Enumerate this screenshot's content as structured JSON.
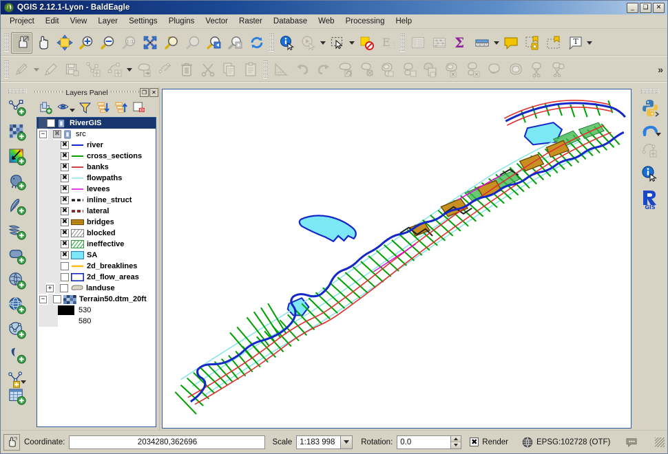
{
  "window": {
    "title": "QGIS 2.12.1-Lyon - BaldEagle",
    "app_icon": "qgis-logo-icon",
    "minimize": "_",
    "maximize": "❑",
    "close": "✕"
  },
  "menubar": {
    "items": [
      {
        "label": "Project",
        "name": "menu-project"
      },
      {
        "label": "Edit",
        "name": "menu-edit"
      },
      {
        "label": "View",
        "name": "menu-view"
      },
      {
        "label": "Layer",
        "name": "menu-layer"
      },
      {
        "label": "Settings",
        "name": "menu-settings"
      },
      {
        "label": "Plugins",
        "name": "menu-plugins"
      },
      {
        "label": "Vector",
        "name": "menu-vector"
      },
      {
        "label": "Raster",
        "name": "menu-raster"
      },
      {
        "label": "Database",
        "name": "menu-database"
      },
      {
        "label": "Web",
        "name": "menu-web"
      },
      {
        "label": "Processing",
        "name": "menu-processing"
      },
      {
        "label": "Help",
        "name": "menu-help"
      }
    ]
  },
  "toolbar_map_navigation": {
    "overflow_label": "»",
    "buttons": [
      {
        "name": "touch-zoom-pan-icon",
        "title": "Touch zoom and pan",
        "state": "active"
      },
      {
        "name": "pan-map-icon",
        "title": "Pan Map",
        "state": "enabled"
      },
      {
        "name": "pan-map-to-selection-icon",
        "title": "Pan Map to Selection",
        "state": "enabled"
      },
      {
        "name": "zoom-in-icon",
        "title": "Zoom In",
        "state": "enabled"
      },
      {
        "name": "zoom-out-icon",
        "title": "Zoom Out",
        "state": "enabled"
      },
      {
        "name": "zoom-native-resolution-icon",
        "title": "Zoom to Native Resolution",
        "state": "disabled"
      },
      {
        "name": "zoom-full-icon",
        "title": "Zoom Full",
        "state": "enabled"
      },
      {
        "name": "zoom-to-selection-icon",
        "title": "Zoom to Selection",
        "state": "enabled"
      },
      {
        "name": "zoom-to-layer-icon",
        "title": "Zoom to Layer",
        "state": "disabled"
      },
      {
        "name": "zoom-last-icon",
        "title": "Zoom Last",
        "state": "enabled"
      },
      {
        "name": "zoom-next-icon",
        "title": "Zoom Next",
        "state": "enabled"
      },
      {
        "name": "refresh-icon",
        "title": "Refresh",
        "state": "enabled"
      },
      {
        "name": "identify-features-icon",
        "title": "Identify Features",
        "state": "enabled"
      },
      {
        "name": "run-feature-action-icon",
        "title": "Run Feature Action",
        "state": "disabled"
      },
      {
        "name": "select-features-icon",
        "title": "Select Features by area or single click",
        "state": "enabled"
      },
      {
        "name": "deselect-features-icon",
        "title": "Deselect Features from All Layers",
        "state": "enabled"
      },
      {
        "name": "select-by-expression-icon",
        "title": "Select Features using an Expression",
        "state": "disabled"
      },
      {
        "name": "open-attribute-table-icon",
        "title": "Open Attribute Table",
        "state": "disabled"
      },
      {
        "name": "field-calculator-icon",
        "title": "Open Field Calculator",
        "state": "disabled"
      },
      {
        "name": "statistical-summary-icon",
        "title": "Show Statistical Summary",
        "state": "enabled"
      },
      {
        "name": "measure-line-icon",
        "title": "Measure Line",
        "state": "enabled"
      },
      {
        "name": "map-tips-icon",
        "title": "Show Map Tips",
        "state": "enabled"
      },
      {
        "name": "new-bookmark-icon",
        "title": "New Bookmark",
        "state": "enabled"
      },
      {
        "name": "show-bookmarks-icon",
        "title": "Show Bookmarks",
        "state": "enabled"
      },
      {
        "name": "text-annotation-icon",
        "title": "Text Annotation",
        "state": "enabled"
      }
    ]
  },
  "toolbar_digitizing": {
    "buttons": [
      {
        "name": "current-edits-icon",
        "title": "Current Edits",
        "state": "disabled"
      },
      {
        "name": "toggle-editing-icon",
        "title": "Toggle Editing",
        "state": "disabled"
      },
      {
        "name": "save-layer-edits-icon",
        "title": "Save Layer Edits",
        "state": "disabled"
      },
      {
        "name": "add-feature-node-icon",
        "title": "Add Feature",
        "state": "disabled"
      },
      {
        "name": "add-feature-line-icon",
        "title": "Add Feature",
        "state": "disabled"
      },
      {
        "name": "move-feature-icon",
        "title": "Move Feature",
        "state": "disabled"
      },
      {
        "name": "node-tool-icon",
        "title": "Node Tool",
        "state": "disabled"
      },
      {
        "name": "delete-selected-icon",
        "title": "Delete Selected",
        "state": "disabled"
      },
      {
        "name": "cut-features-icon",
        "title": "Cut Features",
        "state": "disabled"
      },
      {
        "name": "copy-features-icon",
        "title": "Copy Features",
        "state": "disabled"
      },
      {
        "name": "paste-features-icon",
        "title": "Paste Features",
        "state": "disabled"
      },
      {
        "name": "enable-tracing-icon",
        "title": "Enable Tracing",
        "state": "disabled"
      },
      {
        "name": "undo-icon",
        "title": "Undo",
        "state": "disabled"
      },
      {
        "name": "redo-icon",
        "title": "Redo",
        "state": "disabled"
      },
      {
        "name": "rotate-feature-icon",
        "title": "Rotate Feature",
        "state": "disabled"
      },
      {
        "name": "simplify-feature-icon",
        "title": "Simplify Feature",
        "state": "disabled"
      },
      {
        "name": "add-ring-icon",
        "title": "Add Ring",
        "state": "disabled"
      },
      {
        "name": "add-part-icon",
        "title": "Add Part",
        "state": "disabled"
      },
      {
        "name": "fill-ring-icon",
        "title": "Fill Ring",
        "state": "disabled"
      },
      {
        "name": "delete-ring-icon",
        "title": "Delete Ring",
        "state": "disabled"
      },
      {
        "name": "delete-part-icon",
        "title": "Delete Part",
        "state": "disabled"
      },
      {
        "name": "reshape-features-icon",
        "title": "Reshape Features",
        "state": "disabled"
      },
      {
        "name": "offset-curve-icon",
        "title": "Offset Curve",
        "state": "disabled"
      },
      {
        "name": "split-features-icon",
        "title": "Split Features",
        "state": "disabled"
      },
      {
        "name": "split-parts-icon",
        "title": "Split Parts",
        "state": "disabled"
      }
    ]
  },
  "toolbar_manage_layers": {
    "buttons": [
      {
        "name": "add-vector-layer-icon",
        "title": "Add Vector Layer",
        "state": "enabled"
      },
      {
        "name": "add-raster-layer-icon",
        "title": "Add Raster Layer",
        "state": "enabled"
      },
      {
        "name": "add-mesh-layer-icon",
        "title": "Add Mesh Layer",
        "state": "enabled"
      },
      {
        "name": "add-postgis-layer-icon",
        "title": "Add PostGIS Layers",
        "state": "enabled"
      },
      {
        "name": "add-spatialite-layer-icon",
        "title": "Add SpatiaLite Layer",
        "state": "enabled"
      },
      {
        "name": "add-mssql-layer-icon",
        "title": "Add MSSQL Spatial Layer",
        "state": "enabled"
      },
      {
        "name": "add-oracle-layer-icon",
        "title": "Add Oracle Spatial Layer",
        "state": "enabled"
      },
      {
        "name": "add-wms-layer-icon",
        "title": "Add WMS/WMTS Layer",
        "state": "enabled"
      },
      {
        "name": "add-wcs-layer-icon",
        "title": "Add WCS Layer",
        "state": "enabled"
      },
      {
        "name": "add-wfs-layer-icon",
        "title": "Add WFS Layer",
        "state": "enabled"
      },
      {
        "name": "add-delimited-text-layer-icon",
        "title": "Add Delimited Text Layer",
        "state": "enabled"
      },
      {
        "name": "new-shapefile-layer-icon",
        "title": "New Shapefile Layer",
        "state": "enabled"
      },
      {
        "name": "new-memory-layer-icon",
        "title": "New Memory Layer",
        "state": "enabled"
      }
    ]
  },
  "toolbar_plugins": {
    "buttons": [
      {
        "name": "python-console-icon",
        "title": "Python Console",
        "state": "enabled"
      },
      {
        "name": "georeferencer-icon",
        "title": "Georeferencer",
        "state": "enabled"
      },
      {
        "name": "network-analysis-icon",
        "title": "Network Analysis",
        "state": "disabled"
      },
      {
        "name": "metadata-info-icon",
        "title": "Metadata",
        "state": "enabled"
      },
      {
        "name": "rivergis-icon",
        "title": "RiverGIS",
        "state": "enabled"
      }
    ]
  },
  "layers_panel": {
    "title": "Layers Panel",
    "float_button": "❐",
    "close_button": "✕",
    "toolbar": [
      {
        "name": "add-group-icon",
        "title": "Add Group"
      },
      {
        "name": "manage-visibility-icon",
        "title": "Manage Layer Visibility"
      },
      {
        "name": "filter-legend-icon",
        "title": "Filter Legend By Map Content"
      },
      {
        "name": "expand-all-icon",
        "title": "Expand All"
      },
      {
        "name": "collapse-all-icon",
        "title": "Collapse All"
      },
      {
        "name": "remove-layer-icon",
        "title": "Remove Layer/Group"
      }
    ],
    "tree": [
      {
        "label": "RiverGIS",
        "indent": 0,
        "checkbox": "unchecked",
        "selected": true,
        "expander": "none",
        "icon": "group-icon",
        "bold": true
      },
      {
        "label": "src",
        "indent": 1,
        "checkbox": "grayed",
        "selected": false,
        "expander": "minus",
        "icon": "group-icon",
        "bold": false
      },
      {
        "label": "river",
        "indent": 2,
        "checkbox": "checked",
        "selected": false,
        "expander": "none",
        "symbol": "line",
        "color": "#1428c8",
        "bold": true
      },
      {
        "label": "cross_sections",
        "indent": 2,
        "checkbox": "checked",
        "selected": false,
        "expander": "none",
        "symbol": "line",
        "color": "#00a000",
        "bold": true
      },
      {
        "label": "banks",
        "indent": 2,
        "checkbox": "checked",
        "selected": false,
        "expander": "none",
        "symbol": "line",
        "color": "#c00000",
        "bold": true
      },
      {
        "label": "flowpaths",
        "indent": 2,
        "checkbox": "checked",
        "selected": false,
        "expander": "none",
        "symbol": "line",
        "color": "#8ce6e6",
        "bold": true
      },
      {
        "label": "levees",
        "indent": 2,
        "checkbox": "checked",
        "selected": false,
        "expander": "none",
        "symbol": "line",
        "color": "#e000e0",
        "bold": true
      },
      {
        "label": "inline_struct",
        "indent": 2,
        "checkbox": "checked",
        "selected": false,
        "expander": "none",
        "symbol": "dash",
        "color": "#1a1a1a",
        "bold": true
      },
      {
        "label": "lateral",
        "indent": 2,
        "checkbox": "checked",
        "selected": false,
        "expander": "none",
        "symbol": "dash",
        "color": "#a02020",
        "bold": true
      },
      {
        "label": "bridges",
        "indent": 2,
        "checkbox": "checked",
        "selected": false,
        "expander": "none",
        "symbol": "fill",
        "color": "#c08820",
        "bold": true
      },
      {
        "label": "blocked",
        "indent": 2,
        "checkbox": "checked",
        "selected": false,
        "expander": "none",
        "symbol": "hatch-gray",
        "color": "#8a8a8a",
        "bold": true
      },
      {
        "label": "ineffective",
        "indent": 2,
        "checkbox": "checked",
        "selected": false,
        "expander": "none",
        "symbol": "hatch-green",
        "color": "#39b54a",
        "bold": true
      },
      {
        "label": "SA",
        "indent": 2,
        "checkbox": "checked",
        "selected": false,
        "expander": "none",
        "symbol": "fill",
        "color": "#7ce8f6",
        "bold": true
      },
      {
        "label": "2d_breaklines",
        "indent": 2,
        "checkbox": "unchecked",
        "selected": false,
        "expander": "none",
        "symbol": "line",
        "color": "#ffbe00",
        "bold": true
      },
      {
        "label": "2d_flow_areas",
        "indent": 2,
        "checkbox": "unchecked",
        "selected": false,
        "expander": "none",
        "symbol": "fill-outline",
        "color": "#1428c8",
        "bold": true
      },
      {
        "label": "landuse",
        "indent": 1,
        "checkbox": "unchecked",
        "selected": false,
        "expander": "plus",
        "symbol": "polygon",
        "color": "#c8c8c8",
        "bold": true
      },
      {
        "label": "Terrain50.dtm_20ft",
        "indent": 0,
        "checkbox": "unchecked",
        "selected": false,
        "expander": "minus",
        "symbol": "raster",
        "color": "#5a7ebc",
        "bold": true
      },
      {
        "label": "530",
        "indent": 2,
        "checkbox": "none",
        "selected": false,
        "expander": "none",
        "symbol": "fill",
        "color": "#000000",
        "bold": false
      },
      {
        "label": "580",
        "indent": 2,
        "checkbox": "none",
        "selected": false,
        "expander": "none",
        "symbol": "none",
        "color": "#ffffff",
        "bold": false
      }
    ]
  },
  "statusbar": {
    "coordinate_icon": "coordinate-capture-icon",
    "coordinate_label": "Coordinate:",
    "coordinate_value": "2034280,362696",
    "scale_label": "Scale",
    "scale_value": "1:183 998",
    "rotation_label": "Rotation:",
    "rotation_value": "0.0",
    "render_label": "Render",
    "render_checked": "✖",
    "crs_icon": "crs-globe-icon",
    "crs_label": "EPSG:102728 (OTF)",
    "messages_icon": "message-log-icon"
  },
  "map": {
    "background": "#ffffff",
    "colors": {
      "river": "#1428c8",
      "cross_sections": "#00a000",
      "banks": "#e03030",
      "flowpaths": "#8ce6e6",
      "storage_area": "#7ce8f6",
      "storage_area_outline": "#1428c8",
      "bridges": "#c08820",
      "blocked": "#333333"
    }
  }
}
